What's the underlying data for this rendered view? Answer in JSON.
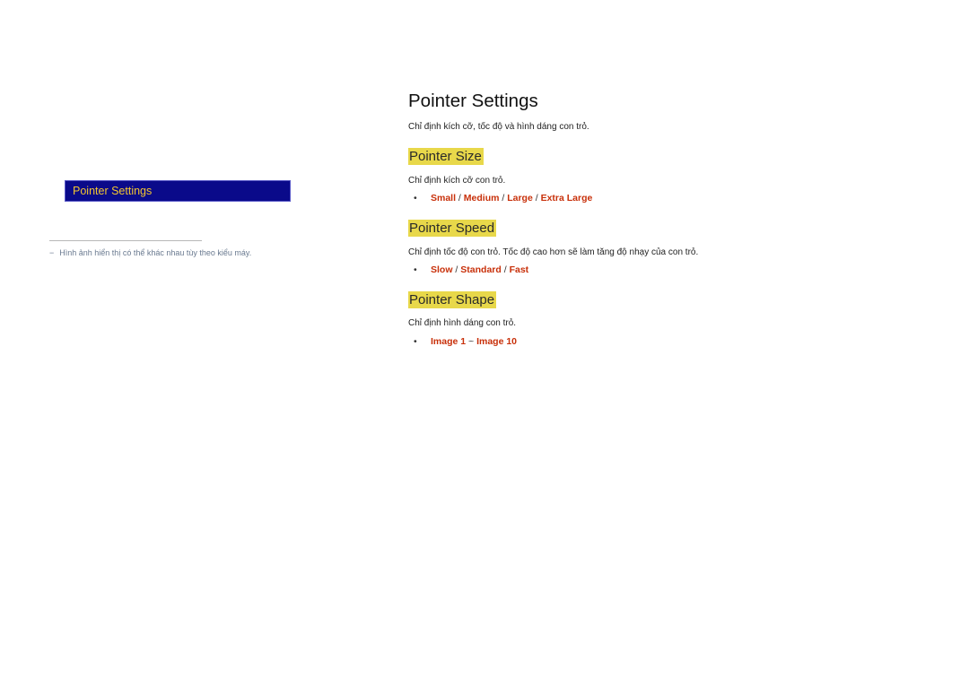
{
  "sidebar": {
    "active_item": "Pointer Settings",
    "highlight_bg": "#0a0a8a",
    "highlight_text_color": "#f2c530"
  },
  "footnote": {
    "dash": "−",
    "text": "Hình ảnh hiển thị có thể khác nhau tùy theo kiểu máy."
  },
  "main": {
    "title": "Pointer Settings",
    "description": "Chỉ định kích cỡ, tốc độ và hình dáng con trỏ.",
    "sections": [
      {
        "heading": "Pointer Size",
        "description": "Chỉ định kích cỡ con trỏ.",
        "options": [
          "Small",
          "Medium",
          "Large",
          "Extra Large"
        ],
        "separator": " / "
      },
      {
        "heading": "Pointer Speed",
        "description": "Chỉ định tốc độ con trỏ. Tốc độ cao hơn sẽ làm tăng độ nhạy của con trỏ.",
        "options": [
          "Slow",
          "Standard",
          "Fast"
        ],
        "separator": " / "
      },
      {
        "heading": "Pointer Shape",
        "description": "Chỉ định hình dáng con trỏ.",
        "options": [
          "Image 1",
          "Image 10"
        ],
        "separator": " ~ "
      }
    ],
    "bullet": "•",
    "heading_highlight": "#e8d84a",
    "option_color": "#c8300a"
  }
}
